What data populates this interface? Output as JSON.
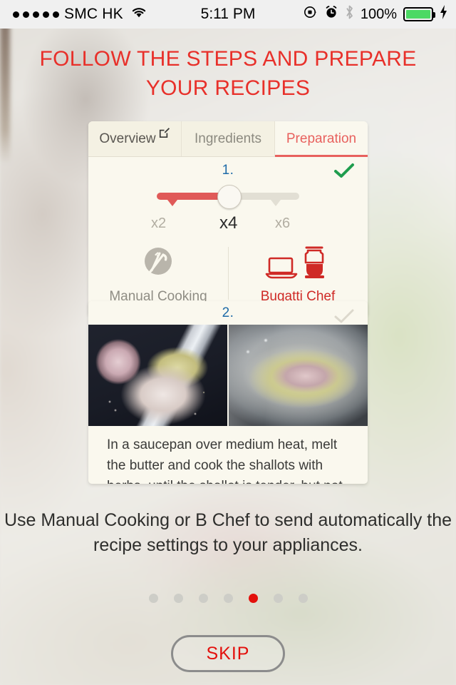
{
  "statusbar": {
    "signal_dots": 5,
    "carrier": "SMC HK",
    "wifi_icon": "wifi-icon",
    "time": "5:11 PM",
    "rotation_lock_icon": "rotation-lock-icon",
    "alarm_icon": "alarm-clock-icon",
    "bluetooth_icon": "bluetooth-icon",
    "battery_percent": "100%",
    "battery_color": "#4cd964",
    "charging_icon": "lightning-bolt-icon"
  },
  "headline": {
    "line1": "FOLLOW THE STEPS AND PREPARE",
    "line2": "YOUR RECIPES",
    "color": "#e8302a"
  },
  "card1": {
    "tabs": [
      {
        "label": "Overview",
        "active": false,
        "icon": "edit-square-icon"
      },
      {
        "label": "Ingredients",
        "active": false
      },
      {
        "label": "Preparation",
        "active": true
      }
    ],
    "active_tab_color": "#e8615e",
    "step": {
      "number": "1.",
      "number_color": "#1f6ba8",
      "status_icon": "green-check-icon",
      "status_color": "#1f9d4e"
    },
    "slider": {
      "options": [
        "x2",
        "x4",
        "x6"
      ],
      "selected": "x4",
      "fill_color": "#e05a58",
      "track_color": "#e2dfd4"
    },
    "modes": [
      {
        "label": "Manual Cooking",
        "icon": "utensils-circle-icon",
        "active": false,
        "color": "#8f8d84"
      },
      {
        "label": "Bugatti Chef",
        "icon": "laptop-blender-icon",
        "active": true,
        "color": "#cf2a26"
      }
    ]
  },
  "card2": {
    "step": {
      "number": "2.",
      "number_color": "#1f6ba8",
      "status_icon": "gray-check-icon"
    },
    "photos": [
      {
        "alt_name": "chopped-shallots-garlic-photo"
      },
      {
        "alt_name": "saucepan-butter-shallots-photo"
      }
    ],
    "instruction": "In a saucepan over medium heat, melt the butter and cook the shallots with herbs, until the shallot is tender, but not"
  },
  "caption": "Use Manual Cooking or B Chef to send automatically the recipe settings to your appliances.",
  "pagination": {
    "total": 7,
    "active_index": 4,
    "active_color": "#e3100c",
    "inactive_color": "#cdcdc7"
  },
  "skip_button": {
    "label": "SKIP",
    "text_color": "#e3100c",
    "border_color": "#8c8c8c"
  }
}
